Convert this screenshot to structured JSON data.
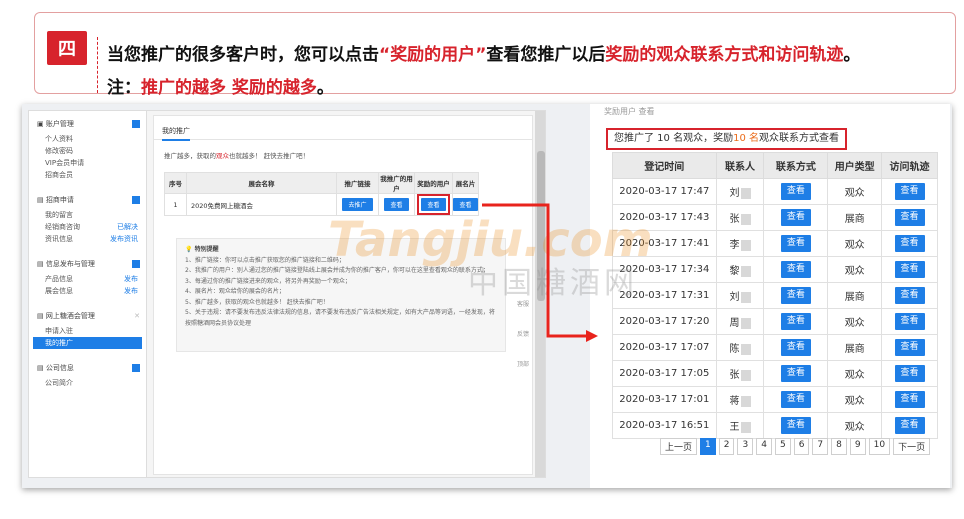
{
  "tip": {
    "number": "四",
    "line1_a": "当您推广的很多客户时，您可以点击",
    "line1_q1": "“",
    "line1_b": "奖励的用户",
    "line1_q2": "”",
    "line1_c": "查看您推广以后",
    "line1_d": "奖励的观众联系方式和访问轨迹",
    "line1_e": "。",
    "line2_a": "注：",
    "line2_b": "推广的越多 奖励的越多",
    "line2_c": "。"
  },
  "sidebar": {
    "sections": [
      {
        "title": "账户管理",
        "items": [
          {
            "label": "个人资料"
          },
          {
            "label": "修改密码"
          },
          {
            "label": "VIP会员申请"
          },
          {
            "label": "招商会员"
          }
        ]
      },
      {
        "title": "招商申请",
        "items": [
          {
            "label": "我的留言"
          },
          {
            "label": "经销商咨询",
            "link": "已解决"
          },
          {
            "label": "资讯信息",
            "link": "发布资讯"
          }
        ]
      },
      {
        "title": "信息发布与管理",
        "items": [
          {
            "label": "产品信息",
            "link": "发布"
          },
          {
            "label": "展会信息",
            "link": "发布"
          }
        ]
      },
      {
        "title": "网上糖酒会管理",
        "items": [
          {
            "label": "申请入驻"
          },
          {
            "label": "我的推广"
          }
        ]
      },
      {
        "title": "公司信息",
        "items": [
          {
            "label": "公司简介"
          }
        ]
      }
    ]
  },
  "main": {
    "tab": "我的推广",
    "hint_a": "推广越多，获取的",
    "hint_b": "观众",
    "hint_c": "也就越多！ 赶快去推广吧！",
    "table": {
      "headers": [
        "序号",
        "展会名称",
        "推广链接",
        "我推广的用户",
        "奖励的用户",
        "展名片"
      ],
      "row": {
        "no": "1",
        "name": "2020免费网上糖酒会",
        "link_btn": "去推广",
        "view1": "查看",
        "view2": "查看",
        "view3": "查看"
      }
    },
    "notes_title": "特别提醒",
    "notes": [
      "1、推广链接：你可以点击推广获取您的推广链接和二维码；",
      "2、我推广的用户：别人通过您的推广链接登陆线上展会并成为你的推广客户，你可以在这里查看观众的联系方式；",
      "3、每通过你的推广链接进来的观众，将另外再奖励一个观众；",
      "4、展名片：观众给你的展会的名片；",
      "5、推广越多，获取的观众也就越多！ 赶快去推广吧！",
      "5、关于违规：请不要发布违反法律法规的信息，请不要发布违反广告法相关规定，如有大产品等词语，一经发现，将按照糖酒网会员协议处理"
    ],
    "side_labels": [
      "客服",
      "反馈",
      "顶部"
    ]
  },
  "watermark": {
    "brand": "Tangjiu.com",
    "cn": "中国糖酒网"
  },
  "right": {
    "crumb": "奖励用户  查看",
    "summary_a": "您推广了 10 名观众，奖励",
    "summary_b": "10 名",
    "summary_c": "观众联系方式查看",
    "headers": [
      "登记时间",
      "联系人",
      "联系方式",
      "用户类型",
      "访问轨迹"
    ],
    "rows": [
      {
        "time": "2020-03-17 17:47",
        "name": "刘",
        "contact": "查看",
        "type": "观众",
        "trace": "查看"
      },
      {
        "time": "2020-03-17 17:43",
        "name": "张",
        "contact": "查看",
        "type": "展商",
        "trace": "查看"
      },
      {
        "time": "2020-03-17 17:41",
        "name": "李",
        "contact": "查看",
        "type": "观众",
        "trace": "查看"
      },
      {
        "time": "2020-03-17 17:34",
        "name": "黎",
        "contact": "查看",
        "type": "观众",
        "trace": "查看"
      },
      {
        "time": "2020-03-17 17:31",
        "name": "刘",
        "contact": "查看",
        "type": "展商",
        "trace": "查看"
      },
      {
        "time": "2020-03-17 17:20",
        "name": "周",
        "contact": "查看",
        "type": "观众",
        "trace": "查看"
      },
      {
        "time": "2020-03-17 17:07",
        "name": "陈",
        "contact": "查看",
        "type": "展商",
        "trace": "查看"
      },
      {
        "time": "2020-03-17 17:05",
        "name": "张",
        "contact": "查看",
        "type": "观众",
        "trace": "查看"
      },
      {
        "time": "2020-03-17 17:01",
        "name": "蒋",
        "contact": "查看",
        "type": "观众",
        "trace": "查看"
      },
      {
        "time": "2020-03-17 16:51",
        "name": "王",
        "contact": "查看",
        "type": "观众",
        "trace": "查看"
      }
    ],
    "pager": {
      "prev": "上一页",
      "pages": [
        "1",
        "2",
        "3",
        "4",
        "5",
        "6",
        "7",
        "8",
        "9",
        "10"
      ],
      "next": "下一页",
      "current": "1"
    }
  },
  "colors": {
    "accent_red": "#d7232c",
    "button_blue": "#1e7ee6",
    "orange": "#ea6d1c"
  }
}
